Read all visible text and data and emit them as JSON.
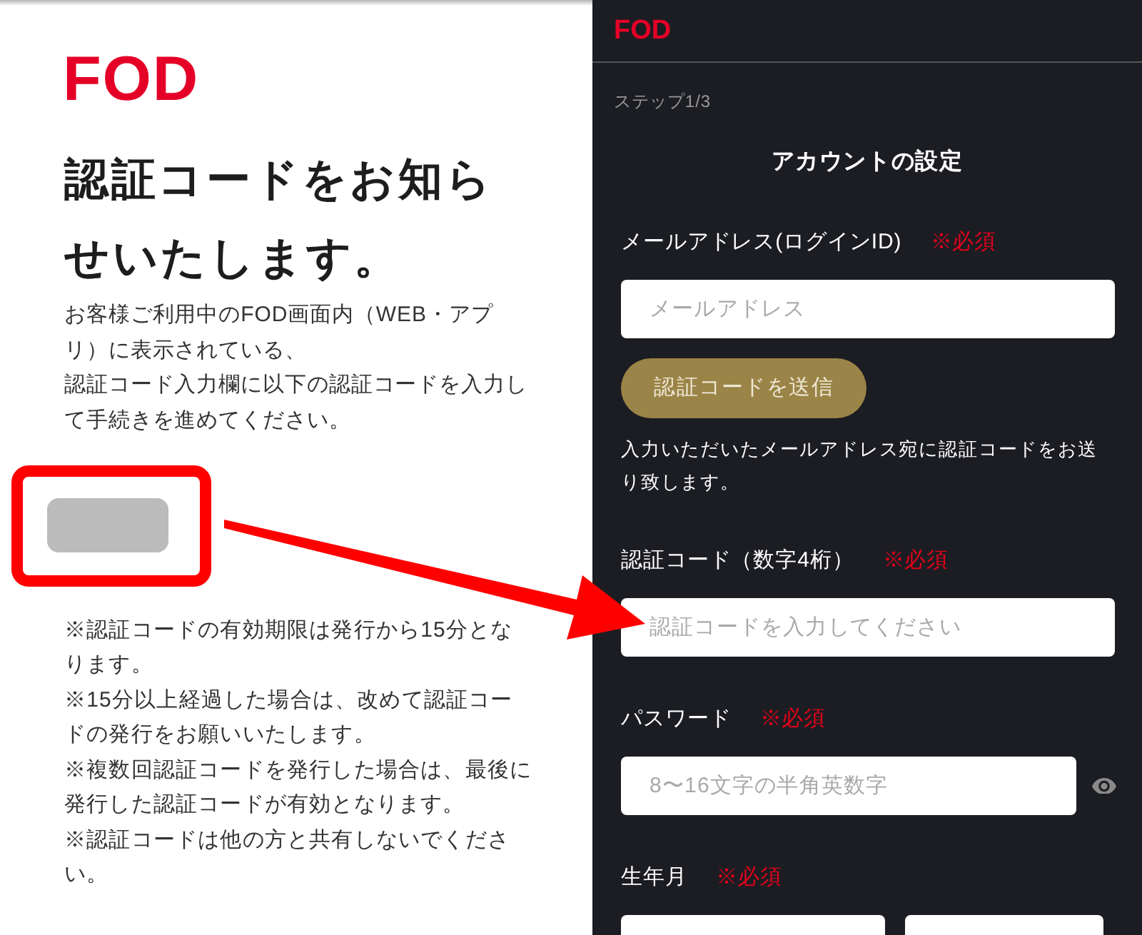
{
  "notice": {
    "logo": "FOD",
    "heading_lines": [
      "認証コードをお知ら",
      "せいたします。"
    ],
    "intro_lines": [
      "お客様ご利用中のFOD画面内（WEB・アプ",
      "リ）に表示されている、",
      "認証コード入力欄に以下の認証コードを入力し",
      "て手続きを進めてください。"
    ],
    "notes": [
      {
        "lines": [
          "※認証コードの有効期限は発行から15分とな",
          "ります。"
        ]
      },
      {
        "lines": [
          "※15分以上経過した場合は、改めて認証コー",
          "ドの発行をお願いいたします。"
        ]
      },
      {
        "lines": [
          "※複数回認証コードを発行した場合は、最後に",
          "発行した認証コードが有効となります。"
        ]
      },
      {
        "lines": [
          "※認証コードは他の方と共有しないでくださ",
          "い。"
        ]
      }
    ]
  },
  "form": {
    "logo": "FOD",
    "step": "ステップ1/3",
    "title": "アカウントの設定",
    "fields": [
      {
        "kind": "email",
        "label": "メールアドレス(ログインID)",
        "required_mark": "※必須",
        "placeholder": "メールアドレス",
        "button": "認証コードを送信",
        "help_lines": [
          "入力いただいたメールアドレス宛に認証コードをお送",
          "り致します。"
        ]
      },
      {
        "kind": "code",
        "label": "認証コード（数字4桁）",
        "required_mark": "※必須",
        "placeholder": "認証コードを入力してください"
      },
      {
        "kind": "password",
        "label": "パスワード",
        "required_mark": "※必須",
        "placeholder": "8〜16文字の半角英数字"
      },
      {
        "kind": "birth",
        "label": "生年月",
        "required_mark": "※必須"
      }
    ]
  }
}
